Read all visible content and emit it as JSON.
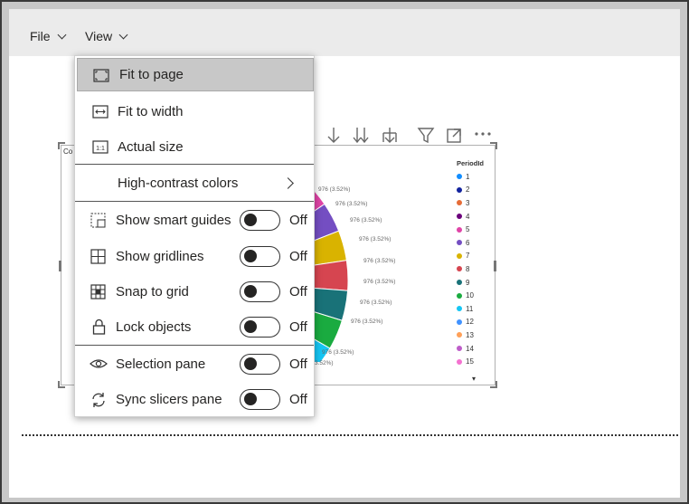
{
  "menubar": {
    "file_label": "File",
    "view_label": "View"
  },
  "view_menu": {
    "items": [
      {
        "label": "Fit to page",
        "icon": "fit-page-icon",
        "selected": true
      },
      {
        "label": "Fit to width",
        "icon": "fit-width-icon"
      },
      {
        "label": "Actual size",
        "icon": "actual-size-icon",
        "icon_text": "1:1"
      },
      {
        "label": "High-contrast colors",
        "icon": "chevron-right-icon"
      },
      {
        "label": "Show smart guides",
        "icon": "smart-guides-icon",
        "state": "Off"
      },
      {
        "label": "Show gridlines",
        "icon": "gridlines-icon",
        "state": "Off"
      },
      {
        "label": "Snap to grid",
        "icon": "snap-grid-icon",
        "state": "Off"
      },
      {
        "label": "Lock objects",
        "icon": "lock-icon",
        "state": "Off"
      },
      {
        "label": "Selection pane",
        "icon": "eye-icon",
        "state": "Off"
      },
      {
        "label": "Sync slicers pane",
        "icon": "sync-icon",
        "state": "Off"
      }
    ]
  },
  "visual": {
    "title_fragment": "Co",
    "legend_title": "PeriodId",
    "legend": [
      {
        "label": "1",
        "color": "#118dff"
      },
      {
        "label": "2",
        "color": "#12239e"
      },
      {
        "label": "3",
        "color": "#e66c37"
      },
      {
        "label": "4",
        "color": "#6b007b"
      },
      {
        "label": "5",
        "color": "#e044a7"
      },
      {
        "label": "6",
        "color": "#744ec2"
      },
      {
        "label": "7",
        "color": "#d9b300"
      },
      {
        "label": "8",
        "color": "#d64550"
      },
      {
        "label": "9",
        "color": "#197278"
      },
      {
        "label": "10",
        "color": "#1aab40"
      },
      {
        "label": "11",
        "color": "#15c6f4"
      },
      {
        "label": "12",
        "color": "#4092ff"
      },
      {
        "label": "13",
        "color": "#ffa058"
      },
      {
        "label": "14",
        "color": "#be5dc9"
      },
      {
        "label": "15",
        "color": "#f472d0"
      }
    ],
    "data_labels": [
      "976 (3.52%)",
      "976 (3.52%)",
      "976 (3.52%)",
      "976 (3.52%)",
      "976 (3.52%)",
      "976 (3.52%)",
      "976 (3.52%)",
      "976 (3.52%)",
      "976 (3.52%)",
      "3.52%)"
    ]
  },
  "chart_data": {
    "type": "pie",
    "title": "",
    "legend_title": "PeriodId",
    "categories": [
      "1",
      "2",
      "3",
      "4",
      "5",
      "6",
      "7",
      "8",
      "9",
      "10",
      "11",
      "12",
      "13",
      "14",
      "15"
    ],
    "visible_slice_value": 976,
    "visible_slice_percent": 3.52
  }
}
